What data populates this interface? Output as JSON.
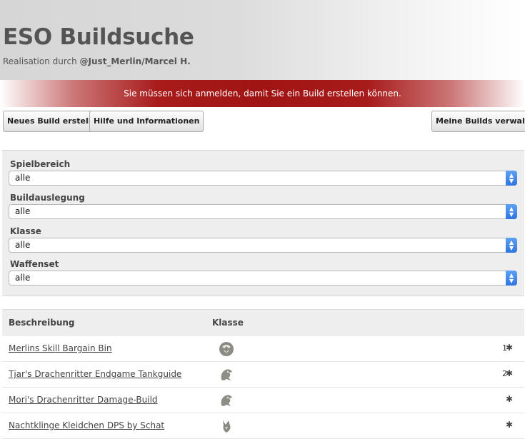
{
  "header": {
    "title": "ESO Buildsuche",
    "subtitle_prefix": "Realisation durch",
    "subtitle_author": "@Just_Merlin/Marcel H."
  },
  "alert": {
    "message": "Sie müssen sich anmelden, damit Sie ein Build erstellen können.",
    "color": "#a01414"
  },
  "toolbar": {
    "new_build": "Neues Build erstellen",
    "help": "Hilfe und Informationen",
    "my_builds": "Meine Builds verwalten"
  },
  "filters": [
    {
      "label": "Spielbereich",
      "value": "alle"
    },
    {
      "label": "Buildauslegung",
      "value": "alle"
    },
    {
      "label": "Klasse",
      "value": "alle"
    },
    {
      "label": "Waffenset",
      "value": "alle"
    }
  ],
  "table": {
    "columns": [
      "Beschreibung",
      "Klasse"
    ],
    "rows": [
      {
        "name": "Merlins Skill Bargain Bin",
        "class_icon": "warden-icon",
        "count": "1"
      },
      {
        "name": "Tjar's Drachenritter Endgame Tankguide",
        "class_icon": "dragonknight-icon",
        "count": "2"
      },
      {
        "name": "Mori's Drachenritter Damage-Build",
        "class_icon": "dragonknight-icon",
        "count": ""
      },
      {
        "name": "Nachtklinge Kleidchen DPS by Schat",
        "class_icon": "nightblade-icon",
        "count": ""
      }
    ]
  },
  "icons": {
    "select_arrows": "updown-arrows-icon",
    "settings": "gear-icon"
  }
}
